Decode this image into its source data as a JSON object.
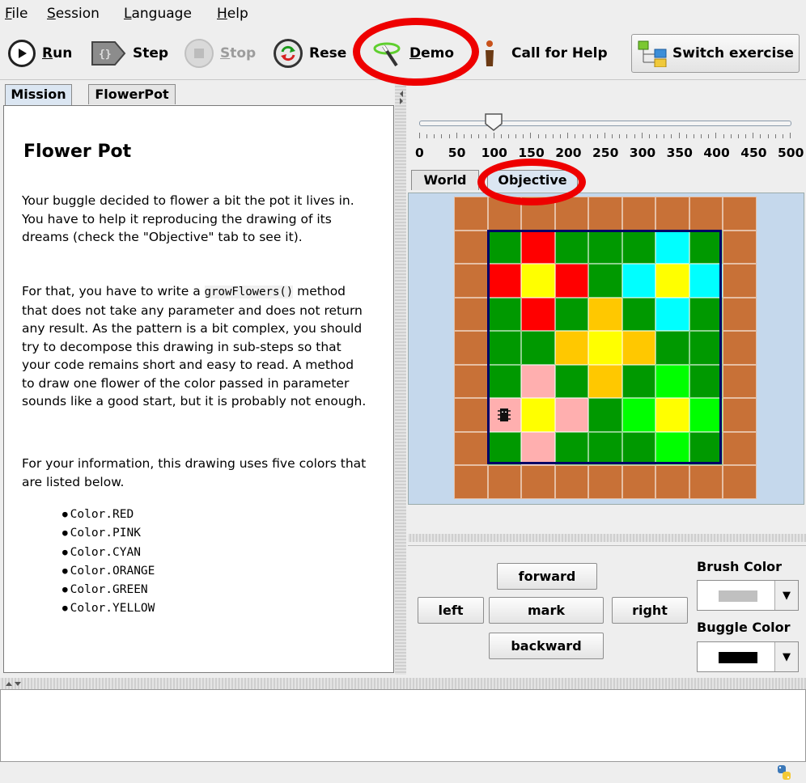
{
  "menu": [
    {
      "mnemonic": "F",
      "rest": "ile"
    },
    {
      "mnemonic": "S",
      "rest": "ession"
    },
    {
      "mnemonic": "L",
      "rest": "anguage"
    },
    {
      "mnemonic": "H",
      "rest": "elp"
    }
  ],
  "toolbar": {
    "run_mn": "R",
    "run_rest": "un",
    "step_label": "Step",
    "stop_mn": "S",
    "stop_rest": "top",
    "reset_label": "Rese",
    "demo_mn": "D",
    "demo_rest": "emo",
    "help_label": "Call for Help",
    "switch_label": "Switch exercise"
  },
  "left_tabs": [
    "Mission",
    "FlowerPot"
  ],
  "mission": {
    "title": "Flower Pot",
    "p1": "Your buggle decided to flower a bit the pot it lives in. You have to help it reproducing the drawing of its dreams (check the \"Objective\" tab to see it).",
    "p2_before": "For that, you have to write a ",
    "p2_code": "growFlowers()",
    "p2_after": " method that does not take any parameter and does not return any result. As the pattern is a bit complex, you should try to decompose this drawing in sub-steps so that your code remains short and easy to read. A method to draw one flower of the color passed in parameter sounds like a good start, but it is probably not enough.",
    "p3": "For your information, this drawing uses five colors that are listed below.",
    "colors": [
      "Color.RED",
      "Color.PINK",
      "Color.CYAN",
      "Color.ORANGE",
      "Color.GREEN",
      "Color.YELLOW"
    ]
  },
  "speed": {
    "value": 100,
    "min": 0,
    "max": 500,
    "ticks": [
      "0",
      "50",
      "100",
      "150",
      "200",
      "250",
      "300",
      "350",
      "400",
      "450",
      "500"
    ]
  },
  "right_tabs": [
    "World",
    "Objective"
  ],
  "world": {
    "palette": {
      "B": "#c87137",
      "G": "#009900",
      "R": "#ff0000",
      "Y": "#ffff00",
      "C": "#00ffff",
      "O": "#ffc800",
      "P": "#ffafaf",
      "L": "#00ff00"
    },
    "rows": [
      "BBBBBBBBB",
      "BGRGGGCGB",
      "BRYRGCYCB",
      "BGRGOGCGB",
      "BGGOYOGGB",
      "BGPGOGLGB",
      "BPYPGLYLB",
      "BGPGGGLGB",
      "BBBBBBBBB"
    ],
    "buggle_row": 6,
    "buggle_col": 1
  },
  "controls": {
    "forward": "forward",
    "left": "left",
    "mark": "mark",
    "right": "right",
    "backward": "backward",
    "brush_label": "Brush Color",
    "buggle_label": "Buggle Color",
    "brush_color": "#c0c0c0",
    "buggle_color": "#000000"
  }
}
